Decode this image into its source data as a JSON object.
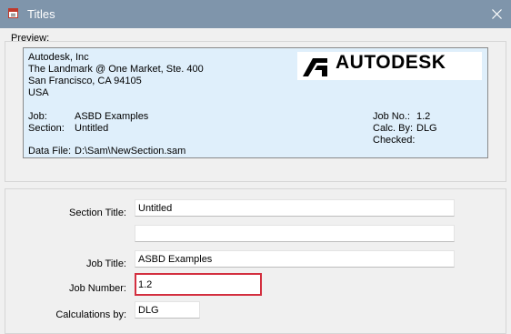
{
  "window": {
    "title": "Titles"
  },
  "preview": {
    "label": "Preview:",
    "company": "Autodesk, Inc",
    "address1": "The Landmark @ One Market, Ste. 400",
    "address2": "San Francisco, CA 94105",
    "country": "USA",
    "logo_text": "AUTODESK",
    "job_label": "Job:",
    "job_value": "ASBD Examples",
    "section_label": "Section:",
    "section_value": "Untitled",
    "data_file_label": "Data File:",
    "data_file_value": "D:\\Sam\\NewSection.sam",
    "job_no_label": "Job No.:",
    "job_no_value": "1.2",
    "calc_by_label": "Calc. By:",
    "calc_by_value": "DLG",
    "checked_label": "Checked:"
  },
  "form": {
    "section_title_label": "Section Title:",
    "section_title_value": "Untitled",
    "section_title_line2_value": "",
    "job_title_label": "Job Title:",
    "job_title_value": "ASBD Examples",
    "job_number_label": "Job Number:",
    "job_number_value": "1.2",
    "calculations_by_label": "Calculations by:",
    "calculations_by_value": "DLG"
  },
  "colors": {
    "titlebar": "#7f95ab",
    "preview_bg": "#dfeffb",
    "highlight": "#d32f3f"
  }
}
